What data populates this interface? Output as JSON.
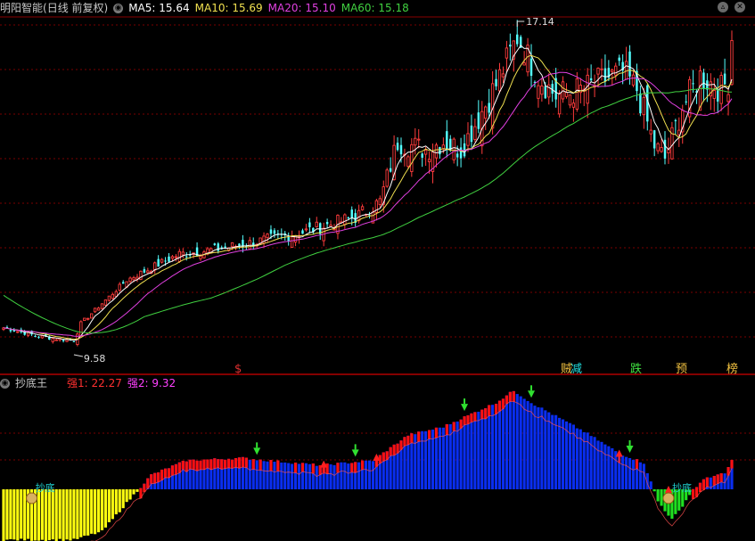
{
  "main_panel": {
    "stock_name": "明阳智能",
    "period": "(日线 前复权)",
    "ma": [
      {
        "label": "MA5: 15.64",
        "color": "#ffffff"
      },
      {
        "label": "MA10: 15.69",
        "color": "#f0e050"
      },
      {
        "label": "MA20: 15.10",
        "color": "#e040e0"
      },
      {
        "label": "MA60: 15.18",
        "color": "#40d040"
      }
    ],
    "high_label": "17.14",
    "low_label": "9.58",
    "signal_labels": [
      {
        "text": "$",
        "color": "#e03030"
      },
      {
        "text": "贼",
        "color": "#f0c040"
      },
      {
        "text": "减",
        "color": "#20e0e0"
      },
      {
        "text": "跌",
        "color": "#40e040"
      },
      {
        "text": "预",
        "color": "#f0c040"
      },
      {
        "text": "榜",
        "color": "#f0c040"
      }
    ]
  },
  "sub_panel": {
    "name": "抄底王",
    "metrics": [
      {
        "label": "强1: 22.27",
        "color": "#ff3030"
      },
      {
        "label": "强2: 9.32",
        "color": "#ff40ff"
      }
    ],
    "markers": [
      {
        "text": "抄底",
        "color": "#20d0d0"
      },
      {
        "text": "抄底",
        "color": "#20d0d0"
      }
    ]
  },
  "colors": {
    "up": "#ff3c3c",
    "down": "#54ffff",
    "grid": "#7a0000",
    "ma5": "#ffffff",
    "ma10": "#f0e050",
    "ma20": "#e040e0",
    "ma60": "#40d040",
    "bar_blue": "#0a2ef0",
    "bar_red": "#ff1010",
    "bar_yellow": "#ffff10",
    "bar_green": "#20e020",
    "arrow_up": "#ff2020",
    "arrow_down": "#30e030"
  },
  "chart_data": {
    "type": "candlestick",
    "y_range": [
      9.58,
      17.14
    ],
    "high_point": 17.14,
    "low_point": 9.58,
    "ma_last": {
      "MA5": 15.64,
      "MA10": 15.69,
      "MA20": 15.1,
      "MA60": 15.18
    },
    "close_keypoints": [
      {
        "i": 0,
        "v": 10.2
      },
      {
        "i": 10,
        "v": 10.0
      },
      {
        "i": 20,
        "v": 9.9
      },
      {
        "i": 22,
        "v": 10.3
      },
      {
        "i": 35,
        "v": 11.3
      },
      {
        "i": 50,
        "v": 11.9
      },
      {
        "i": 60,
        "v": 12.0
      },
      {
        "i": 70,
        "v": 12.15
      },
      {
        "i": 85,
        "v": 12.4
      },
      {
        "i": 100,
        "v": 12.75
      },
      {
        "i": 107,
        "v": 13.1
      },
      {
        "i": 112,
        "v": 14.5
      },
      {
        "i": 120,
        "v": 14.3
      },
      {
        "i": 125,
        "v": 14.5
      },
      {
        "i": 130,
        "v": 14.3
      },
      {
        "i": 140,
        "v": 15.8
      },
      {
        "i": 146,
        "v": 16.9
      },
      {
        "i": 152,
        "v": 16.0
      },
      {
        "i": 157,
        "v": 15.55
      },
      {
        "i": 165,
        "v": 15.7
      },
      {
        "i": 170,
        "v": 15.9
      },
      {
        "i": 176,
        "v": 16.1
      },
      {
        "i": 180,
        "v": 15.7
      },
      {
        "i": 185,
        "v": 14.4
      },
      {
        "i": 188,
        "v": 14.1
      },
      {
        "i": 193,
        "v": 15.3
      },
      {
        "i": 198,
        "v": 16.0
      },
      {
        "i": 204,
        "v": 15.7
      },
      {
        "i": 206,
        "v": 15.9
      },
      {
        "i": 207,
        "v": 16.9
      }
    ],
    "sub_indicator_keypoints": [
      {
        "i": 0,
        "v": -42
      },
      {
        "i": 20,
        "v": -42
      },
      {
        "i": 28,
        "v": -35
      },
      {
        "i": 36,
        "v": -8
      },
      {
        "i": 42,
        "v": 12
      },
      {
        "i": 52,
        "v": 24
      },
      {
        "i": 68,
        "v": 26
      },
      {
        "i": 75,
        "v": 24
      },
      {
        "i": 90,
        "v": 20
      },
      {
        "i": 105,
        "v": 24
      },
      {
        "i": 115,
        "v": 45
      },
      {
        "i": 125,
        "v": 52
      },
      {
        "i": 140,
        "v": 72
      },
      {
        "i": 145,
        "v": 82
      },
      {
        "i": 150,
        "v": 72
      },
      {
        "i": 165,
        "v": 48
      },
      {
        "i": 175,
        "v": 30
      },
      {
        "i": 182,
        "v": 22
      },
      {
        "i": 186,
        "v": -10
      },
      {
        "i": 190,
        "v": -25
      },
      {
        "i": 192,
        "v": -18
      },
      {
        "i": 196,
        "v": 0
      },
      {
        "i": 200,
        "v": 10
      },
      {
        "i": 205,
        "v": 13
      },
      {
        "i": 207,
        "v": 24
      }
    ]
  }
}
